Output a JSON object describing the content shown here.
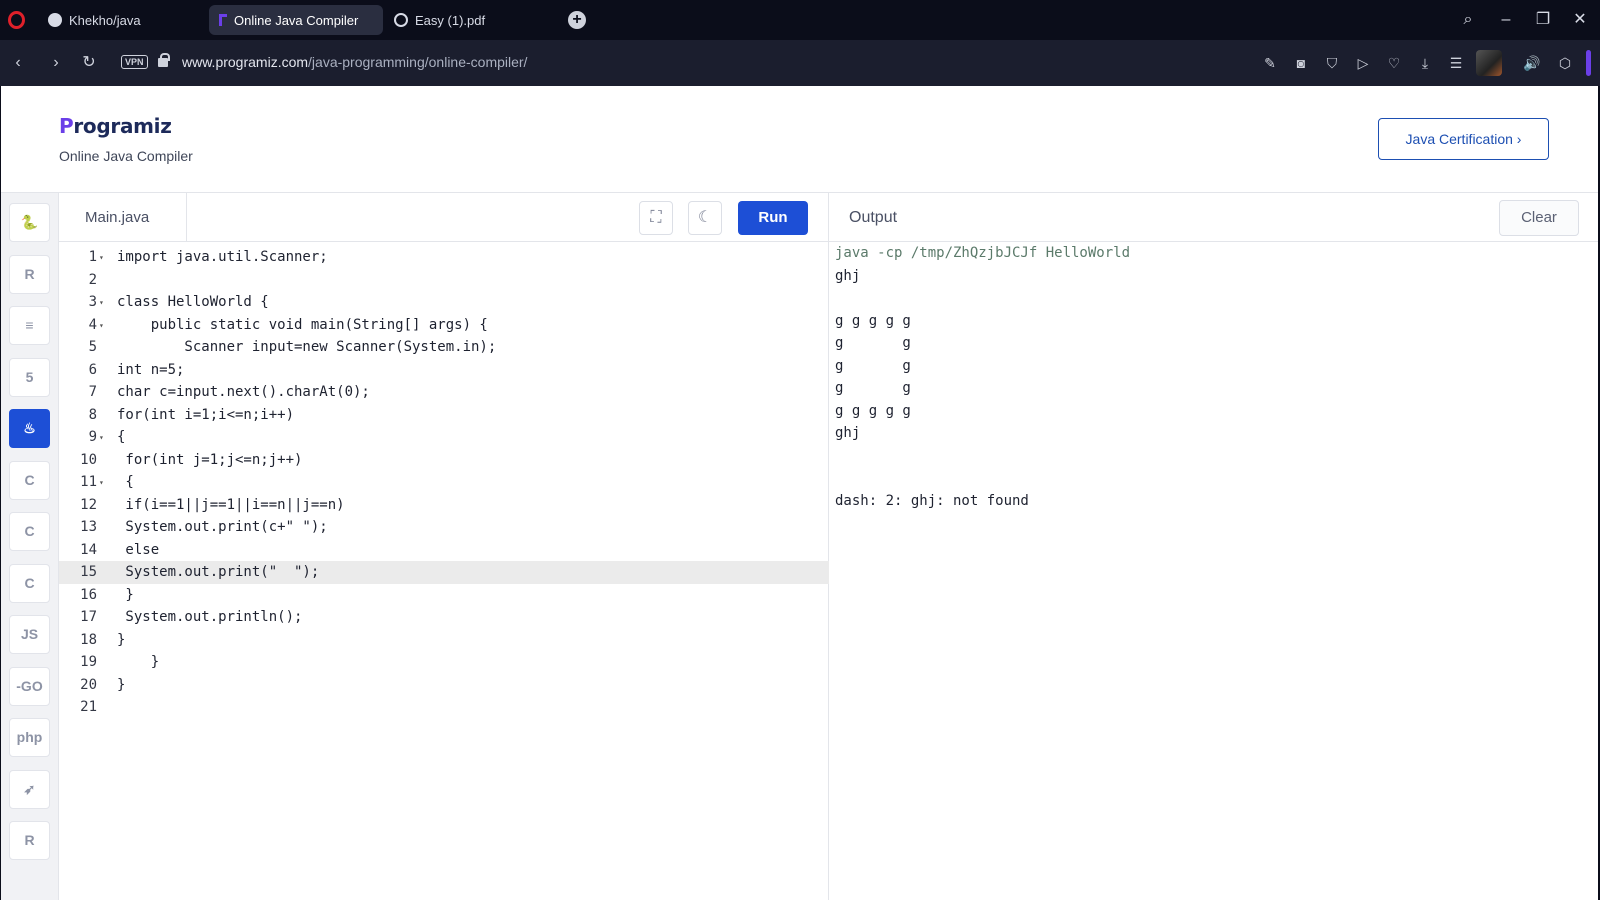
{
  "browser": {
    "tabs": [
      {
        "title": "Khekho/java",
        "icon": "github-icon",
        "active": false
      },
      {
        "title": "Online Java Compiler",
        "icon": "programiz-icon",
        "active": true
      },
      {
        "title": "Easy (1).pdf",
        "icon": "globe-icon",
        "active": false
      }
    ],
    "new_tab": "+",
    "vpn_label": "VPN",
    "url_host": "www.programiz.com",
    "url_path": "/java-programming/online-compiler/"
  },
  "header": {
    "logo_first": "P",
    "logo_rest": "rogramiz",
    "subtitle": "Online Java Compiler",
    "cert_button": "Java Certification ›"
  },
  "languages": [
    {
      "name": "python",
      "glyph": "🐍",
      "active": false
    },
    {
      "name": "r",
      "glyph": "R",
      "active": false
    },
    {
      "name": "sql",
      "glyph": "≡",
      "active": false
    },
    {
      "name": "html",
      "glyph": "5",
      "active": false
    },
    {
      "name": "java",
      "glyph": "♨",
      "active": true
    },
    {
      "name": "c",
      "glyph": "C",
      "active": false
    },
    {
      "name": "cpp",
      "glyph": "C",
      "active": false
    },
    {
      "name": "csharp",
      "glyph": "C",
      "active": false
    },
    {
      "name": "javascript",
      "glyph": "JS",
      "active": false
    },
    {
      "name": "go",
      "glyph": "-GO",
      "active": false
    },
    {
      "name": "php",
      "glyph": "php",
      "active": false
    },
    {
      "name": "swift",
      "glyph": "➶",
      "active": false
    },
    {
      "name": "rust",
      "glyph": "R",
      "active": false
    }
  ],
  "editor": {
    "file_tab": "Main.java",
    "run_label": "Run",
    "highlighted_line": 15,
    "lines": [
      {
        "n": "1",
        "fold": true,
        "text": "import java.util.Scanner;"
      },
      {
        "n": "2",
        "fold": false,
        "text": ""
      },
      {
        "n": "3",
        "fold": true,
        "text": "class HelloWorld {"
      },
      {
        "n": "4",
        "fold": true,
        "text": "    public static void main(String[] args) {"
      },
      {
        "n": "5",
        "fold": false,
        "text": "        Scanner input=new Scanner(System.in);"
      },
      {
        "n": "6",
        "fold": false,
        "text": "int n=5;"
      },
      {
        "n": "7",
        "fold": false,
        "text": "char c=input.next().charAt(0);"
      },
      {
        "n": "8",
        "fold": false,
        "text": "for(int i=1;i<=n;i++)"
      },
      {
        "n": "9",
        "fold": true,
        "text": "{"
      },
      {
        "n": "10",
        "fold": false,
        "text": " for(int j=1;j<=n;j++)"
      },
      {
        "n": "11",
        "fold": true,
        "text": " {"
      },
      {
        "n": "12",
        "fold": false,
        "text": " if(i==1||j==1||i==n||j==n)"
      },
      {
        "n": "13",
        "fold": false,
        "text": " System.out.print(c+\" \");"
      },
      {
        "n": "14",
        "fold": false,
        "text": " else"
      },
      {
        "n": "15",
        "fold": false,
        "text": " System.out.print(\"  \");"
      },
      {
        "n": "16",
        "fold": false,
        "text": " }"
      },
      {
        "n": "17",
        "fold": false,
        "text": " System.out.println();"
      },
      {
        "n": "18",
        "fold": false,
        "text": "}"
      },
      {
        "n": "19",
        "fold": false,
        "text": "    }"
      },
      {
        "n": "20",
        "fold": false,
        "text": "}"
      },
      {
        "n": "21",
        "fold": false,
        "text": ""
      }
    ]
  },
  "output": {
    "title": "Output",
    "clear_label": "Clear",
    "lines": [
      "java -cp /tmp/ZhQzjbJCJf HelloWorld",
      "ghj",
      "",
      "g g g g g",
      "g       g",
      "g       g",
      "g       g",
      "g g g g g",
      "ghj",
      "",
      "",
      "dash: 2: ghj: not found"
    ]
  }
}
